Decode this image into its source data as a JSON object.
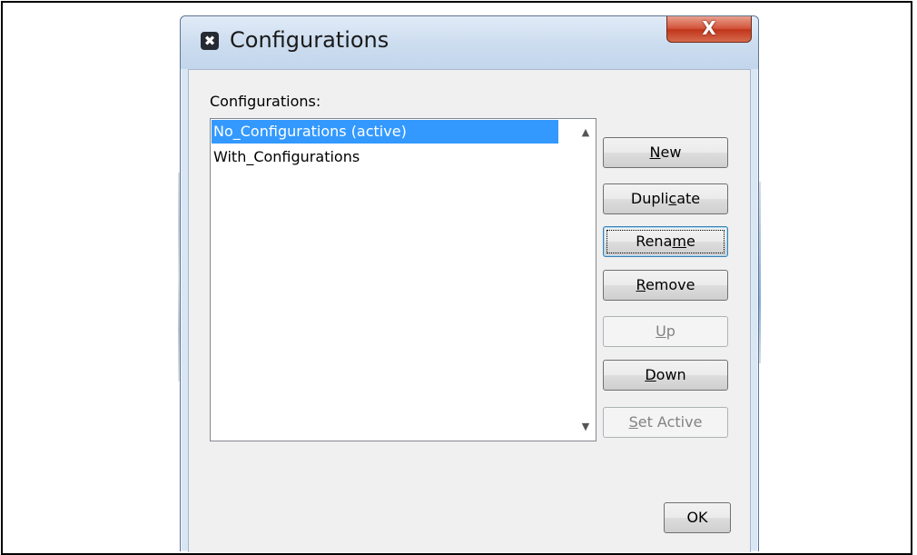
{
  "dialog": {
    "title": "Configurations",
    "app_icon_glyph": "✖",
    "close_glyph": "X"
  },
  "list": {
    "label": "Configurations:",
    "items": [
      {
        "label": "No_Configurations (active)",
        "selected": true
      },
      {
        "label": "With_Configurations",
        "selected": false
      }
    ],
    "scroll_up_glyph": "▲",
    "scroll_down_glyph": "▼"
  },
  "buttons": {
    "new": {
      "pre": "",
      "mn": "N",
      "post": "ew"
    },
    "duplicate": {
      "pre": "Dupli",
      "mn": "c",
      "post": "ate"
    },
    "rename": {
      "pre": "Rena",
      "mn": "m",
      "post": "e"
    },
    "remove": {
      "pre": "",
      "mn": "R",
      "post": "emove"
    },
    "up": {
      "pre": "",
      "mn": "U",
      "post": "p"
    },
    "down": {
      "pre": "",
      "mn": "D",
      "post": "own"
    },
    "set_active": {
      "pre": "",
      "mn": "S",
      "post": "et Active"
    },
    "ok": {
      "label": "OK"
    }
  },
  "colors": {
    "selection": "#3399ff",
    "titlebar": "#cbdcef",
    "close": "#c1351b"
  }
}
